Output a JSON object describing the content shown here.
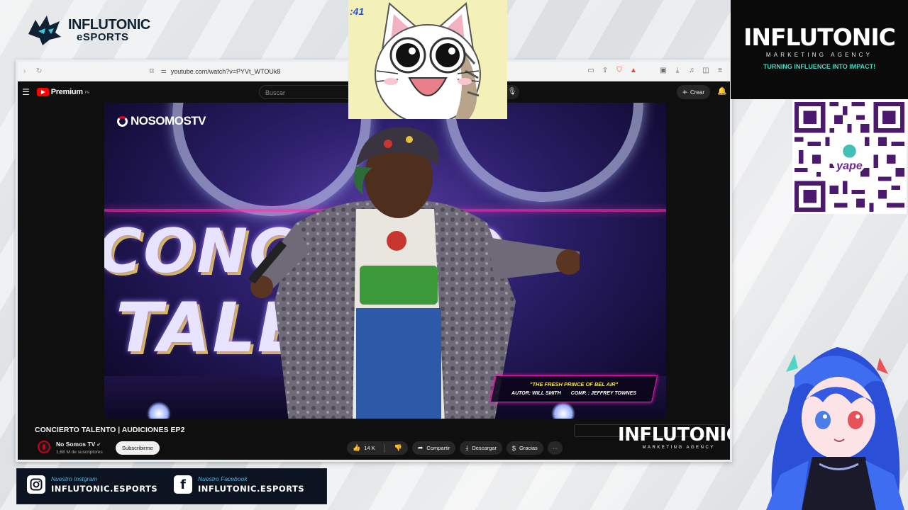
{
  "stream": {
    "brand_top": "INFLUTONIC",
    "brand_sub": "eSPORTS",
    "agency_name": "INFLUTONIC",
    "agency_sub": "MARKETING AGENCY",
    "agency_tagline": "TURNING INFLUENCE INTO IMPACT!",
    "qr_label": "yape",
    "timer": ":41",
    "socials": [
      {
        "caption": "Nuestro Instgram",
        "handle": "INFLUTONIC.ESPORTS",
        "icon": "instagram-icon"
      },
      {
        "caption": "Nuestro Facebook",
        "handle": "INFLUTONIC.ESPORTS",
        "icon": "facebook-icon"
      }
    ],
    "overlay_logo": "INFLUTONIC",
    "overlay_logo_sub": "MARKETING AGENCY"
  },
  "browser": {
    "url": "youtube.com/watch?v=PYVt_WTOUk8",
    "toolbar_icons": [
      "back-icon",
      "forward-icon",
      "reload-icon",
      "bookmark-icon",
      "site-info-icon",
      "cast-icon",
      "share-icon",
      "brave-shield-icon",
      "brave-rewards-icon",
      "sidebar-icon",
      "download-icon",
      "media-icon",
      "split-view-icon",
      "menu-icon"
    ]
  },
  "youtube": {
    "logo_text": "Premium",
    "region": "PE",
    "search_placeholder": "Buscar",
    "create_label": "Crear",
    "video": {
      "channel_bug": "NOSOMOSTV",
      "stage_text_1": "CONCIERTO",
      "stage_text_2": "TALENTO",
      "lower_third_title": "\"THE FRESH PRINCE OF BEL AIR\"",
      "lower_third_author": "AUTOR: WILL SMITH",
      "lower_third_comp": "COMP. : JEFFREY TOWNES"
    },
    "title": "CONCIERTO TALENTO | AUDICIONES EP2",
    "channel_name": "No Somos TV",
    "subscribers": "1,68 M de suscriptores",
    "subscribe_label": "Subscribirme",
    "likes": "14 K",
    "share_label": "Compartir",
    "download_label": "Descargar",
    "thanks_label": "Gracias",
    "more_label": "···"
  },
  "colors": {
    "accent_teal": "#4fd6c4",
    "yt_red": "#ff0000",
    "neon_pink": "#e01aa8",
    "qr_purple": "#4b1a6e"
  }
}
